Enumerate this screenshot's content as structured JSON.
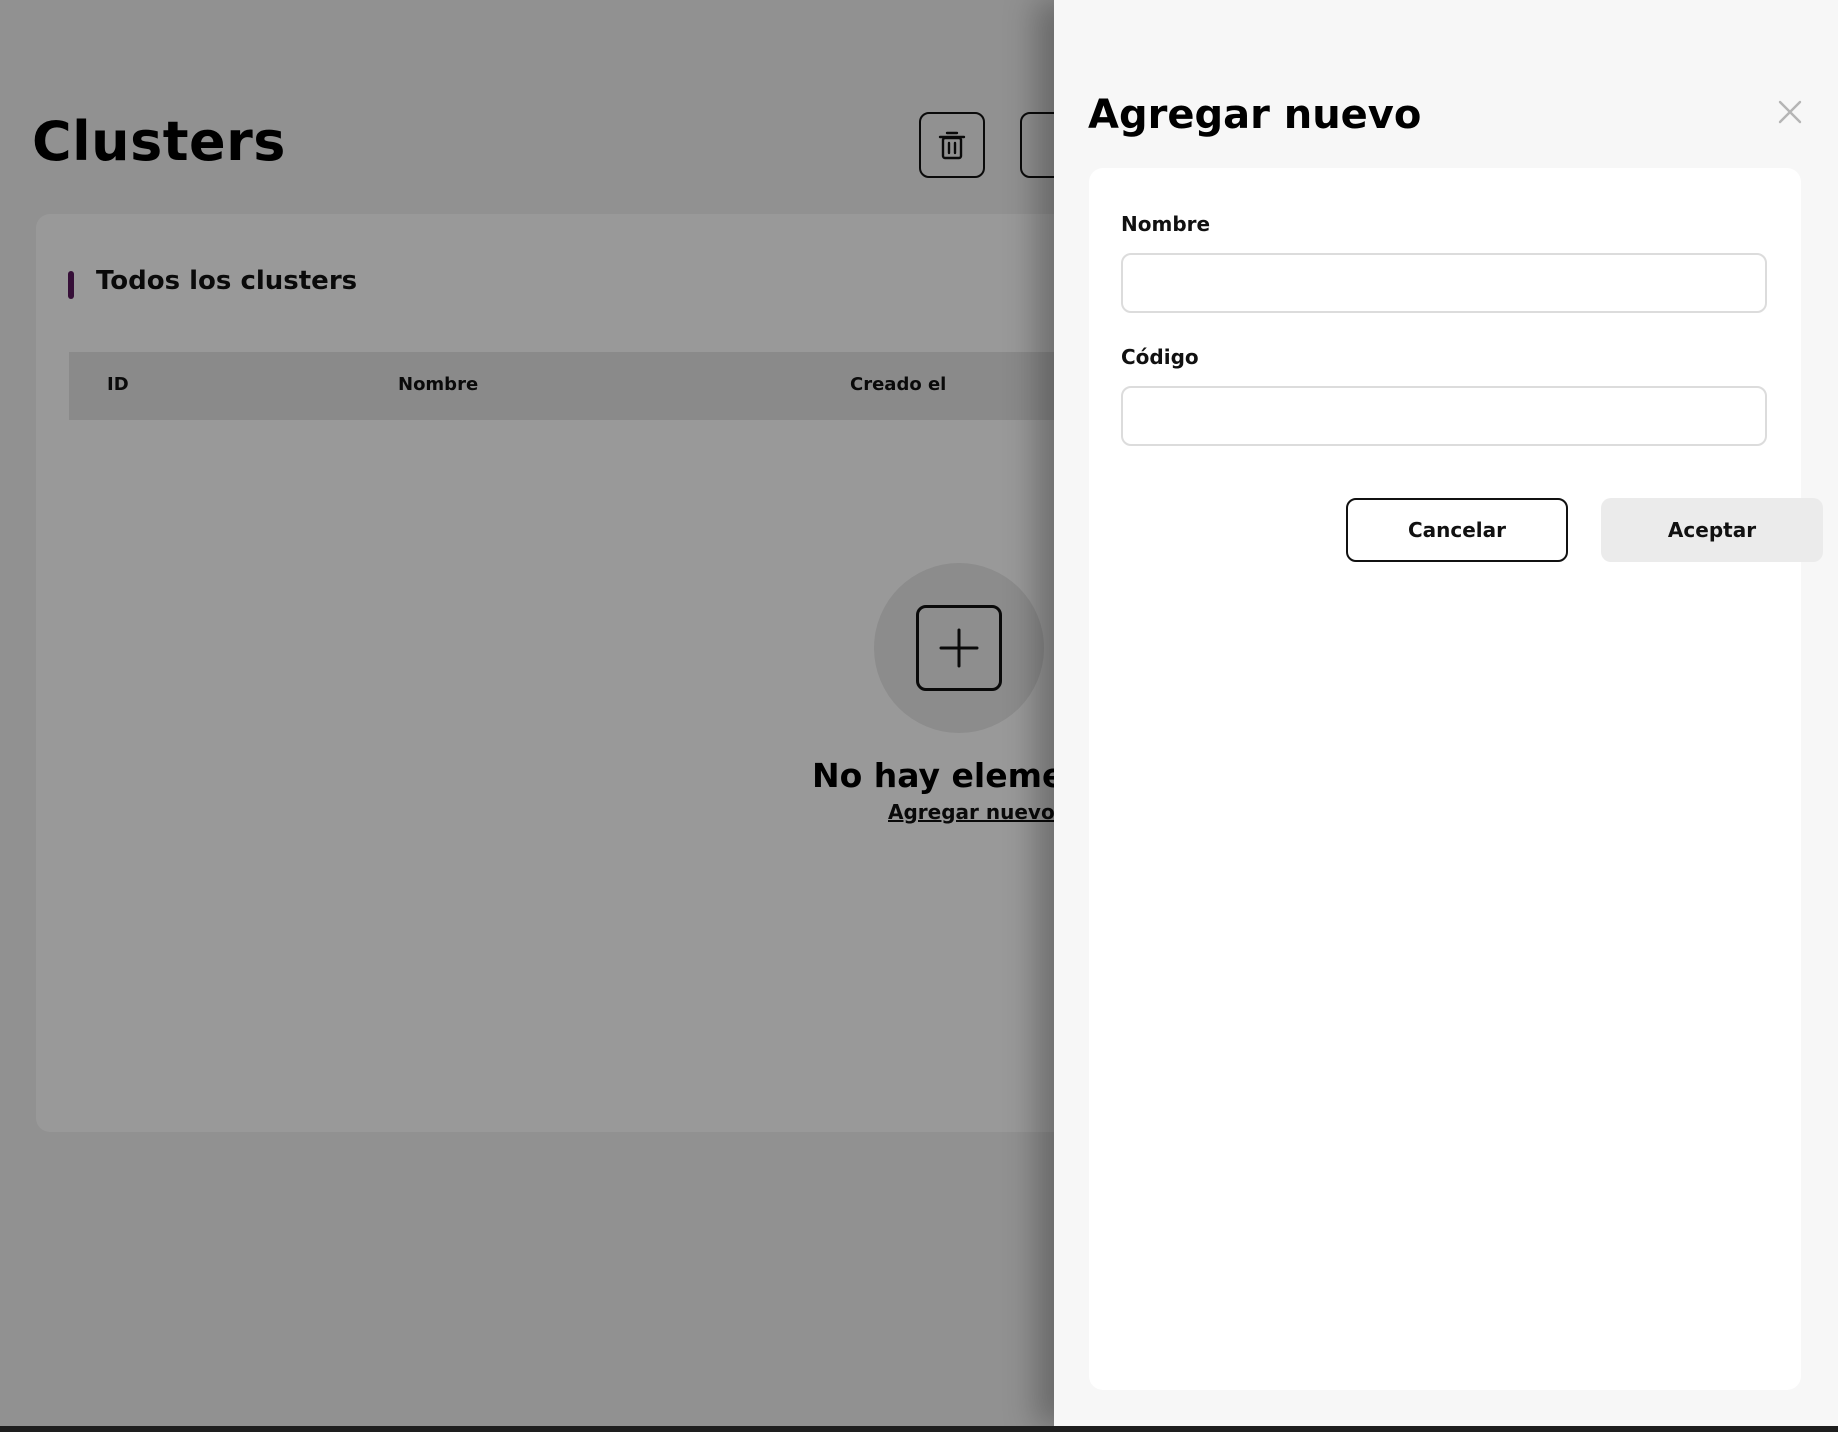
{
  "page": {
    "title": "Clusters",
    "toolbar": {
      "delete_icon": "trash-icon"
    },
    "card": {
      "title": "Todos los clusters",
      "accent_color": "#5a1a5e",
      "columns": [
        "ID",
        "Nombre",
        "Creado el"
      ]
    },
    "empty_state": {
      "icon": "plus-square-icon",
      "message": "No hay elemen",
      "link_label": "Agregar nuevo"
    }
  },
  "drawer": {
    "title": "Agregar nuevo",
    "close_icon": "close-icon",
    "fields": [
      {
        "label": "Nombre",
        "value": "",
        "placeholder": ""
      },
      {
        "label": "Código",
        "value": "",
        "placeholder": ""
      }
    ],
    "buttons": {
      "cancel_label": "Cancelar",
      "accept_label": "Aceptar"
    }
  }
}
